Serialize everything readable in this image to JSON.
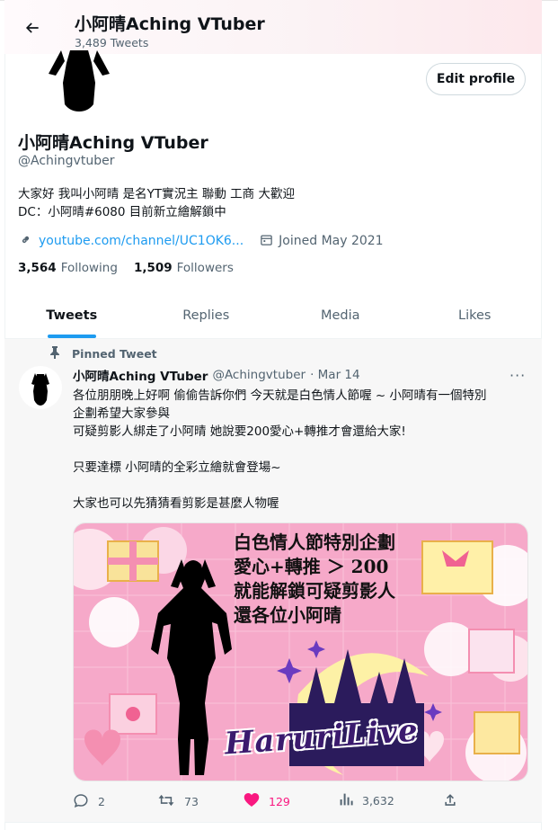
{
  "header": {
    "title": "小阿晴Aching VTuber",
    "tweet_count": "3,489 Tweets"
  },
  "profile": {
    "name": "小阿晴Aching VTuber",
    "handle": "@Achingvtuber",
    "bio": "大家好 我叫小阿晴 是名YT實況主 聯動 工商 大歡迎\nDC：小阿晴#6080 目前新立繪解鎖中",
    "link": "youtube.com/channel/UC1OK6...",
    "joined": "Joined May 2021",
    "following_count": "3,564",
    "following_label": "Following",
    "followers_count": "1,509",
    "followers_label": "Followers",
    "edit_label": "Edit profile"
  },
  "tabs": [
    {
      "label": "Tweets",
      "active": true
    },
    {
      "label": "Replies",
      "active": false
    },
    {
      "label": "Media",
      "active": false
    },
    {
      "label": "Likes",
      "active": false
    }
  ],
  "tweet": {
    "pinned_label": "Pinned Tweet",
    "author": "小阿晴Aching VTuber",
    "handle": "@Achingvtuber",
    "date": "· Mar 14",
    "more": "···",
    "lines": [
      "各位朋朋晚上好啊 偷偷告訴你們 今天就是白色情人節喔 ~ 小阿晴有一個特別",
      "企劃希望大家參與",
      "可疑剪影人綁走了小阿晴 她說要200愛心+轉推才會還給大家!",
      "",
      "只要達標 小阿晴的全彩立繪就會登場~",
      "",
      "大家也可以先猜猜看剪影是甚麼人物喔"
    ],
    "image_text": "白色情人節特別企劃\n愛心+轉推 ＞ 200\n就能解鎖可疑剪影人\n還各位小阿晴",
    "image_logo": "HaruriLive",
    "stats": {
      "replies": "2",
      "retweets": "73",
      "likes": "129",
      "views": "3,632"
    }
  },
  "colors": {
    "accent": "#1d9bf0",
    "like": "#f91880",
    "muted": "#536471",
    "image_bg": "#f6a9c9"
  }
}
